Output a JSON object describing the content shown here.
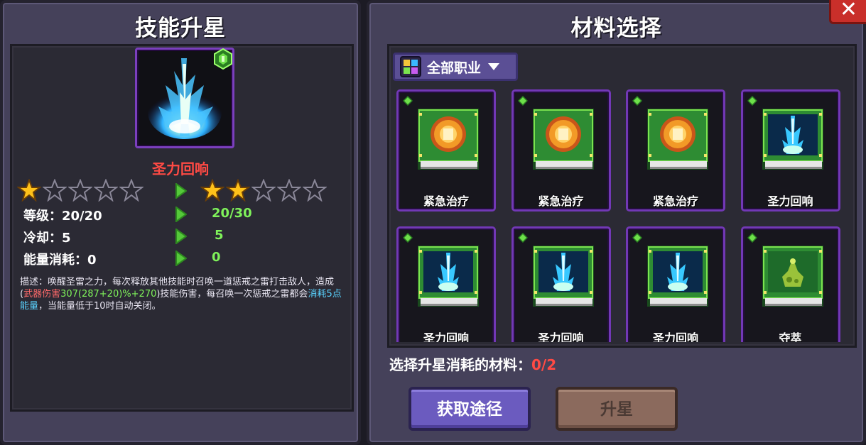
{
  "left_panel": {
    "title": "技能升星",
    "skill_name": "圣力回响",
    "current_stars": 1,
    "next_stars": 2,
    "max_stars": 5,
    "stats": [
      {
        "label": "等级：",
        "current": "20/20",
        "next": "20/30"
      },
      {
        "label": "冷却：",
        "current": "5",
        "next": "5"
      },
      {
        "label": "能量消耗：",
        "current": "0",
        "next": "0"
      }
    ],
    "description": {
      "part1": "描述：唤醒圣雷之力，每次释放其他技能时召唤一道惩戒之雷打击敌人，造成(",
      "weapon_damage": "武器伤害",
      "formula": "307(287+20)%+270",
      "part2": ")技能伤害，每召唤一次惩戒之雷都会",
      "energy_cost": "消耗5点能量",
      "part3": "，当能量低于10时自动关闭。"
    }
  },
  "right_panel": {
    "title": "材料选择",
    "filter_label": "全部职业",
    "materials": [
      {
        "label": "紧急治疗",
        "icon": "medallion-book-icon"
      },
      {
        "label": "紧急治疗",
        "icon": "medallion-book-icon"
      },
      {
        "label": "紧急治疗",
        "icon": "medallion-book-icon"
      },
      {
        "label": "圣力回响",
        "icon": "lightning-book-icon"
      },
      {
        "label": "圣力回响",
        "icon": "lightning-book-icon"
      },
      {
        "label": "圣力回响",
        "icon": "lightning-book-icon"
      },
      {
        "label": "圣力回响",
        "icon": "lightning-book-icon"
      },
      {
        "label": "夺萃",
        "icon": "flask-book-icon"
      }
    ],
    "select_prompt": "选择升星消耗的材料：",
    "select_count": "0/2",
    "obtain_button": "获取途径",
    "upgrade_button": "升星",
    "close_label": "✕"
  },
  "colors": {
    "panel": "#45415a",
    "inner": "#2b2a34",
    "card_border": "#7238b6",
    "accent_red": "#ff4a44",
    "accent_green": "#7ff25a",
    "accent_blue": "#5ad3ff",
    "star": "#ffc21a"
  }
}
